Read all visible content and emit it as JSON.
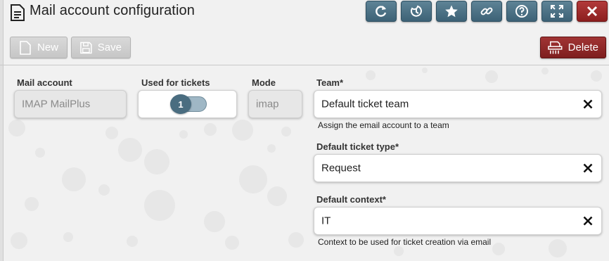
{
  "header": {
    "title": "Mail account configuration",
    "icon_buttons": [
      {
        "name": "refresh-icon"
      },
      {
        "name": "moon-icon"
      },
      {
        "name": "star-icon"
      },
      {
        "name": "link-icon"
      },
      {
        "name": "help-icon"
      },
      {
        "name": "fullscreen-icon"
      },
      {
        "name": "close-icon"
      }
    ]
  },
  "toolbar": {
    "new_label": "New",
    "save_label": "Save",
    "delete_label": "Delete"
  },
  "form": {
    "mail_account": {
      "label": "Mail account",
      "value": "IMAP MailPlus"
    },
    "used_for_tickets": {
      "label": "Used for tickets",
      "value": "1"
    },
    "mode": {
      "label": "Mode",
      "value": "imap"
    },
    "team": {
      "label": "Team*",
      "value": "Default ticket team",
      "help": "Assign the email account to a team"
    },
    "ticket_type": {
      "label": "Default ticket type*",
      "value": "Request"
    },
    "context": {
      "label": "Default context*",
      "value": "IT",
      "help": "Context to be used for ticket creation via email"
    }
  },
  "colors": {
    "accent": "#4a6d80",
    "danger": "#8c1f1f",
    "background": "#f1f1f1"
  }
}
